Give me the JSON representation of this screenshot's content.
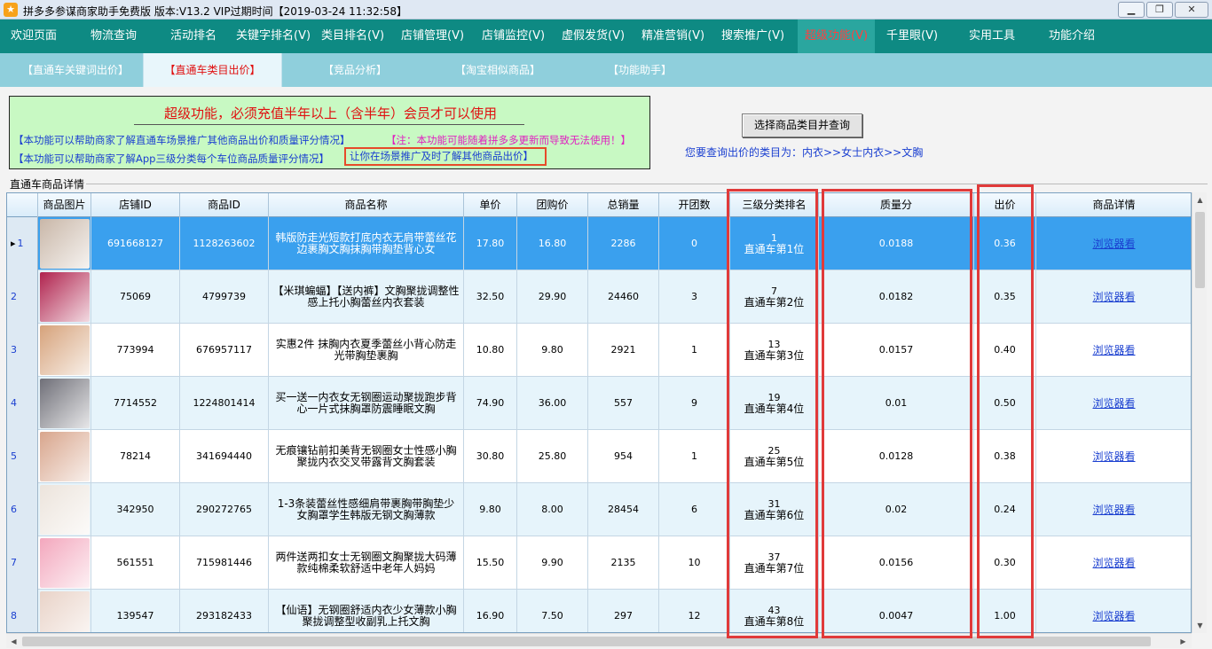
{
  "window": {
    "title": "拼多多参谋商家助手免费版 版本:V13.2 VIP过期时间【2019-03-24 11:32:58】",
    "min_icon": "minimize-icon",
    "max_icon": "restore-icon",
    "close_icon": "close-icon"
  },
  "menu": {
    "items": [
      "欢迎页面",
      "物流查询",
      "活动排名",
      "关键字排名(V)",
      "类目排名(V)",
      "店铺管理(V)",
      "店铺监控(V)",
      "虚假发货(V)",
      "精准营销(V)",
      "搜索推广(V)",
      "超级功能(V)",
      "千里眼(V)",
      "实用工具",
      "功能介绍"
    ],
    "active": "超级功能(V)"
  },
  "subtabs": {
    "items": [
      "【直通车关键词出价】",
      "【直通车类目出价】",
      "【竞品分析】",
      "【淘宝相似商品】",
      "【功能助手】"
    ],
    "active": "【直通车类目出价】"
  },
  "notice": {
    "title": "超级功能，必须充值半年以上（含半年）会员才可以使用",
    "line1": "【本功能可以帮助商家了解直通车场景推广其他商品出价和质量评分情况】",
    "warning": "【注：本功能可能随着拼多多更新而导致无法使用！】",
    "line2": "【本功能可以帮助商家了解App三级分类每个车位商品质量评分情况】",
    "highlight": "让你在场景推广及时了解其他商品出价】"
  },
  "query": {
    "button_label": "选择商品类目并查询",
    "category_text": "您要查询出价的类目为：内衣>>女士内衣>>文胸"
  },
  "grid": {
    "label": "直通车商品详情",
    "columns": [
      "",
      "商品图片",
      "店铺ID",
      "商品ID",
      "商品名称",
      "单价",
      "团购价",
      "总销量",
      "开团数",
      "三级分类排名",
      "质量分",
      "出价",
      "商品详情"
    ],
    "rows": [
      {
        "no": "1",
        "shop_id": "691668127",
        "goods_id": "1128263602",
        "name": "韩版防走光短款打底内衣无肩带蕾丝花边裹胸文胸抹胸带胸垫背心女",
        "price": "17.80",
        "group_price": "16.80",
        "sales": "2286",
        "groups": "0",
        "rank_num": "1",
        "rank_text": "直通车第1位",
        "quality": "0.0188",
        "bid": "0.36",
        "detail": "浏览器看",
        "thumb_color": "#c9b7a8"
      },
      {
        "no": "2",
        "shop_id": "75069",
        "goods_id": "4799739",
        "name": "【米琪蝙蝠】【送内裤】文胸聚拢调整性感上托小胸蕾丝内衣套装",
        "price": "32.50",
        "group_price": "29.90",
        "sales": "24460",
        "groups": "3",
        "rank_num": "7",
        "rank_text": "直通车第2位",
        "quality": "0.0182",
        "bid": "0.35",
        "detail": "浏览器看",
        "thumb_color": "#b0234e"
      },
      {
        "no": "3",
        "shop_id": "773994",
        "goods_id": "676957117",
        "name": "实惠2件 抹胸内衣夏季蕾丝小背心防走光带胸垫裹胸",
        "price": "10.80",
        "group_price": "9.80",
        "sales": "2921",
        "groups": "1",
        "rank_num": "13",
        "rank_text": "直通车第3位",
        "quality": "0.0157",
        "bid": "0.40",
        "detail": "浏览器看",
        "thumb_color": "#d6a27a"
      },
      {
        "no": "4",
        "shop_id": "7714552",
        "goods_id": "1224801414",
        "name": "买一送一内衣女无钢圈运动聚拢跑步背心一片式抹胸罩防震睡眠文胸",
        "price": "74.90",
        "group_price": "36.00",
        "sales": "557",
        "groups": "9",
        "rank_num": "19",
        "rank_text": "直通车第4位",
        "quality": "0.01",
        "bid": "0.50",
        "detail": "浏览器看",
        "thumb_color": "#6f6f78"
      },
      {
        "no": "5",
        "shop_id": "78214",
        "goods_id": "341694440",
        "name": "无痕镶钻前扣美背无钢圈女士性感小胸聚拢内衣交叉带露背文胸套装",
        "price": "30.80",
        "group_price": "25.80",
        "sales": "954",
        "groups": "1",
        "rank_num": "25",
        "rank_text": "直通车第5位",
        "quality": "0.0128",
        "bid": "0.38",
        "detail": "浏览器看",
        "thumb_color": "#d8a58c"
      },
      {
        "no": "6",
        "shop_id": "342950",
        "goods_id": "290272765",
        "name": "1-3条装蕾丝性感细肩带裹胸带胸垫少女胸罩学生韩版无钢文胸薄款",
        "price": "9.80",
        "group_price": "8.00",
        "sales": "28454",
        "groups": "6",
        "rank_num": "31",
        "rank_text": "直通车第6位",
        "quality": "0.02",
        "bid": "0.24",
        "detail": "浏览器看",
        "thumb_color": "#ece4dc"
      },
      {
        "no": "7",
        "shop_id": "561551",
        "goods_id": "715981446",
        "name": "两件送两扣女士无钢圈文胸聚拢大码薄款纯棉柔软舒适中老年人妈妈",
        "price": "15.50",
        "group_price": "9.90",
        "sales": "2135",
        "groups": "10",
        "rank_num": "37",
        "rank_text": "直通车第7位",
        "quality": "0.0156",
        "bid": "0.30",
        "detail": "浏览器看",
        "thumb_color": "#f3a7bd"
      },
      {
        "no": "8",
        "shop_id": "139547",
        "goods_id": "293182433",
        "name": "【仙语】无钢圈舒适内衣少女薄款小胸聚拢调整型收副乳上托文胸",
        "price": "16.90",
        "group_price": "7.50",
        "sales": "297",
        "groups": "12",
        "rank_num": "43",
        "rank_text": "直通车第8位",
        "quality": "0.0047",
        "bid": "1.00",
        "detail": "浏览器看",
        "thumb_color": "#e9d3c8"
      }
    ]
  },
  "scroll": {
    "up_icon": "scroll-up-icon",
    "down_icon": "scroll-down-icon",
    "left_icon": "scroll-left-icon",
    "right_icon": "scroll-right-icon"
  }
}
